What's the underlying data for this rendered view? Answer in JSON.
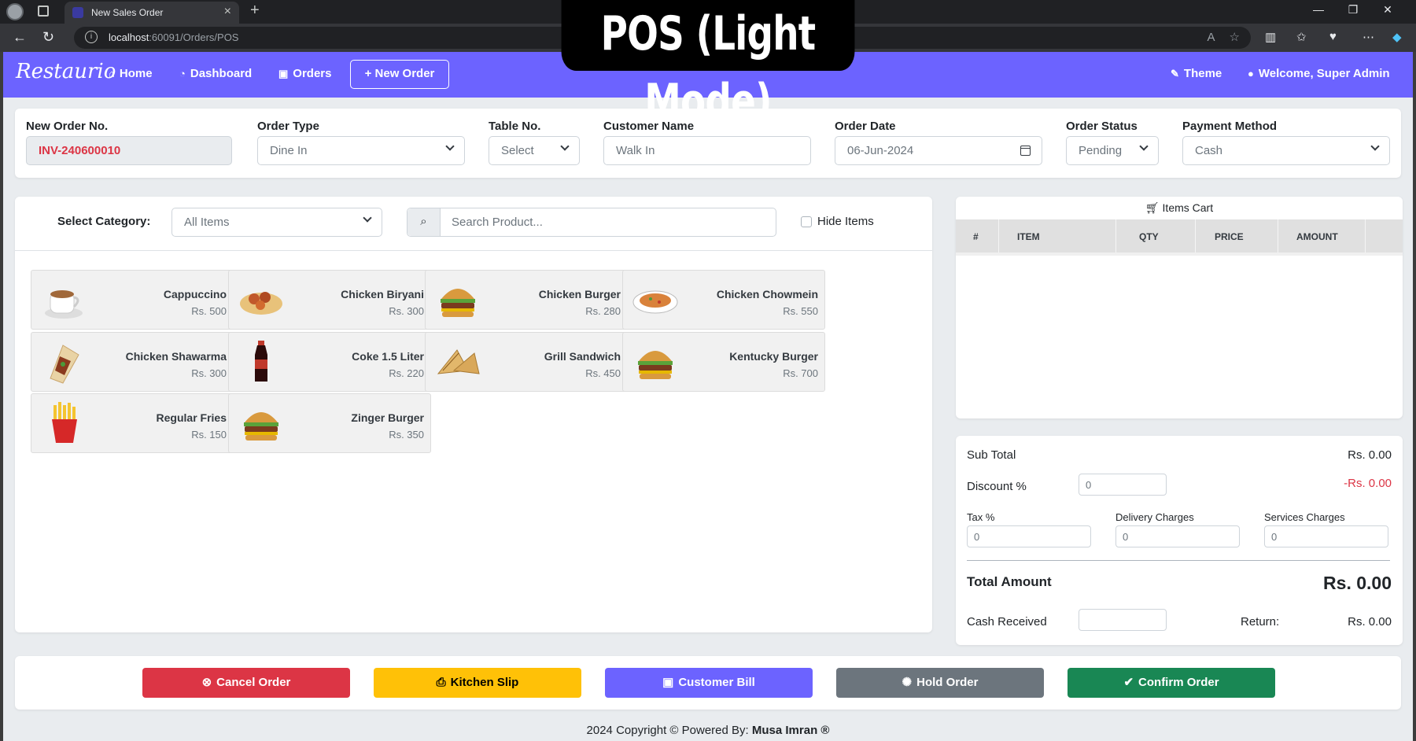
{
  "browser": {
    "tab_title": "New Sales Order",
    "url_host": "localhost",
    "url_path": ":60091/Orders/POS"
  },
  "banner": {
    "text": "POS (Light Mode)"
  },
  "navbar": {
    "brand": "Restaurio",
    "home": "Home",
    "dashboard": "Dashboard",
    "orders": "Orders",
    "new_order": "New Order",
    "theme": "Theme",
    "welcome": "Welcome, Super Admin"
  },
  "order_form": {
    "order_no_label": "New Order No.",
    "order_no": "INV-240600010",
    "order_type_label": "Order Type",
    "order_type": "Dine In",
    "table_label": "Table No.",
    "table": "Select",
    "customer_label": "Customer Name",
    "customer_placeholder": "Walk In",
    "date_label": "Order Date",
    "date": "06-Jun-2024",
    "status_label": "Order Status",
    "status": "Pending",
    "payment_label": "Payment Method",
    "payment": "Cash"
  },
  "products_panel": {
    "category_label": "Select Category:",
    "category": "All Items",
    "search_placeholder": "Search Product...",
    "hide_items": "Hide Items",
    "items": [
      {
        "name": "Cappuccino",
        "price": "Rs. 500",
        "icon": "cappuccino-icon"
      },
      {
        "name": "Chicken Biryani",
        "price": "Rs. 300",
        "icon": "biryani-icon"
      },
      {
        "name": "Chicken Burger",
        "price": "Rs. 280",
        "icon": "burger-icon"
      },
      {
        "name": "Chicken Chowmein",
        "price": "Rs. 550",
        "icon": "chowmein-icon"
      },
      {
        "name": "Chicken Shawarma",
        "price": "Rs. 300",
        "icon": "shawarma-icon"
      },
      {
        "name": "Coke 1.5 Liter",
        "price": "Rs. 220",
        "icon": "coke-bottle-icon"
      },
      {
        "name": "Grill Sandwich",
        "price": "Rs. 450",
        "icon": "sandwich-icon"
      },
      {
        "name": "Kentucky Burger",
        "price": "Rs. 700",
        "icon": "burger-icon"
      },
      {
        "name": "Regular Fries",
        "price": "Rs. 150",
        "icon": "fries-icon"
      },
      {
        "name": "Zinger Burger",
        "price": "Rs. 350",
        "icon": "burger-icon"
      }
    ]
  },
  "cart": {
    "title": "Items Cart",
    "columns": [
      "#",
      "ITEM",
      "QTY",
      "PRICE",
      "AMOUNT"
    ]
  },
  "summary": {
    "subtotal_label": "Sub Total",
    "subtotal": "Rs. 0.00",
    "discount_label": "Discount %",
    "discount_input": "0",
    "discount_value": "-Rs. 0.00",
    "tax_label": "Tax %",
    "tax_input": "0",
    "delivery_label": "Delivery Charges",
    "delivery_input": "0",
    "services_label": "Services Charges",
    "services_input": "0",
    "total_label": "Total Amount",
    "total": "Rs. 0.00",
    "cash_label": "Cash Received",
    "return_label": "Return:",
    "return_value": "Rs. 0.00"
  },
  "actions": {
    "cancel": "Cancel Order",
    "kitchen": "Kitchen Slip",
    "bill": "Customer Bill",
    "hold": "Hold Order",
    "confirm": "Confirm Order"
  },
  "colors": {
    "primary": "#6c63ff",
    "danger": "#dc3545",
    "warning": "#ffc107",
    "secondary": "#6c757d",
    "success": "#198754"
  },
  "footer": {
    "text": "2024 Copyright © Powered By:",
    "author": "Musa Imran ®"
  }
}
